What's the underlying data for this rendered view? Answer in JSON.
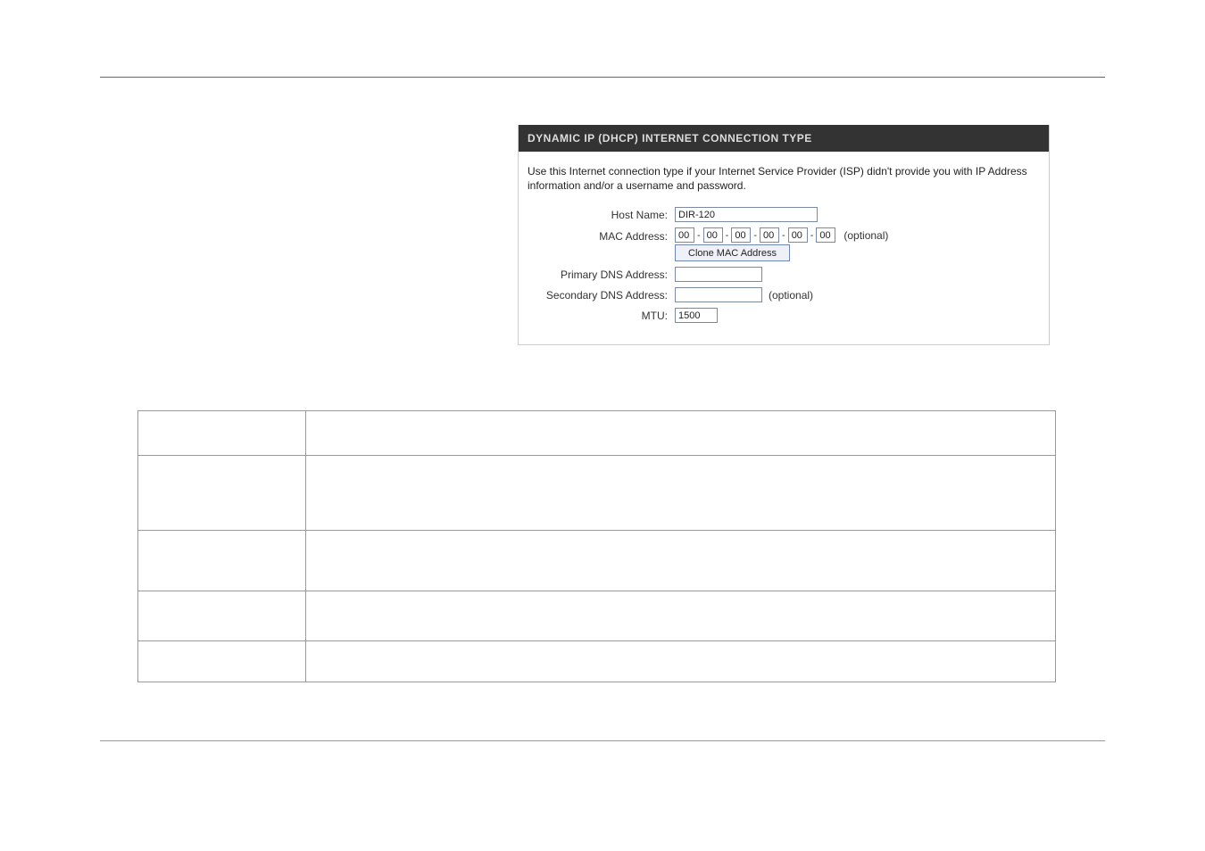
{
  "panel": {
    "header": "DYNAMIC IP (DHCP) INTERNET CONNECTION TYPE",
    "description": "Use this Internet connection type if your Internet Service Provider (ISP) didn't provide you with IP Address information and/or a username and password.",
    "labels": {
      "hostName": "Host Name:",
      "macAddress": "MAC Address:",
      "primaryDns": "Primary DNS Address:",
      "secondaryDns": "Secondary DNS Address:",
      "mtu": "MTU:"
    },
    "values": {
      "hostName": "DIR-120",
      "mac": [
        "00",
        "00",
        "00",
        "00",
        "00",
        "00"
      ],
      "primaryDns": "",
      "secondaryDns": "",
      "mtu": "1500"
    },
    "optionalText": "(optional)",
    "cloneButton": "Clone MAC Address",
    "macSeparator": "-"
  }
}
